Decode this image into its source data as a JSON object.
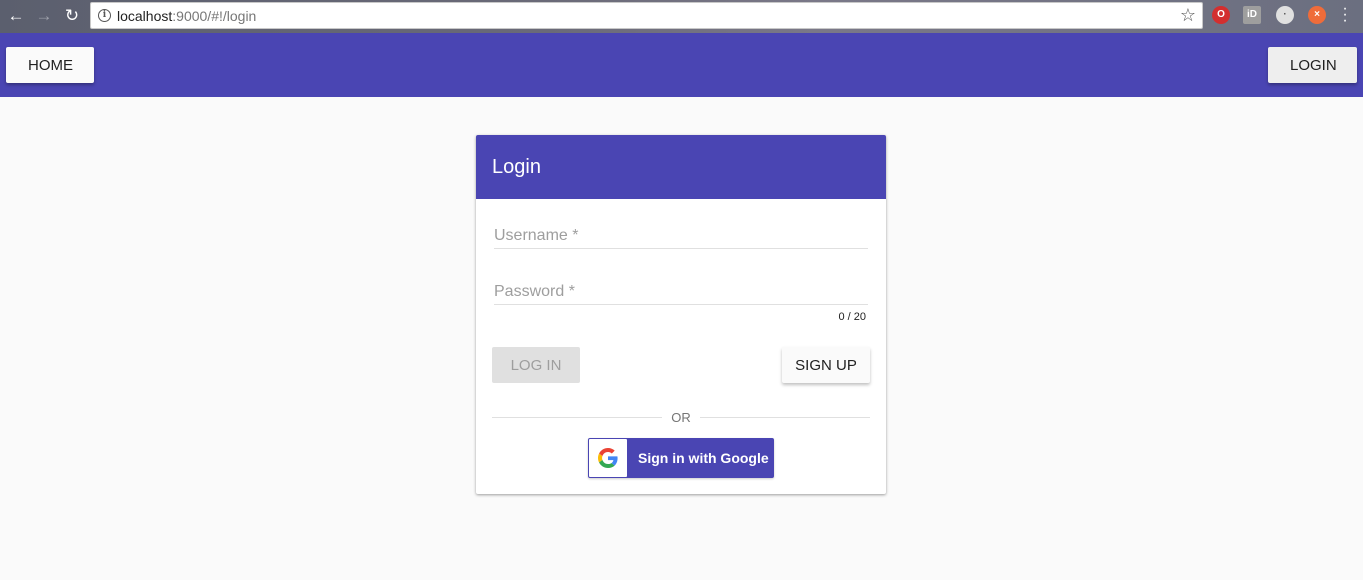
{
  "browser": {
    "url_host": "localhost",
    "url_rest": ":9000/#!/login"
  },
  "toolbar": {
    "home_label": "HOME",
    "login_label": "LOGIN"
  },
  "card": {
    "title": "Login",
    "username_placeholder": "Username *",
    "password_placeholder": "Password *",
    "password_counter": "0 / 20",
    "login_button": "LOG IN",
    "signup_button": "SIGN UP",
    "divider_text": "OR",
    "google_button": "Sign in with Google"
  },
  "colors": {
    "primary": "#4a45b3",
    "background": "#fafafa"
  }
}
